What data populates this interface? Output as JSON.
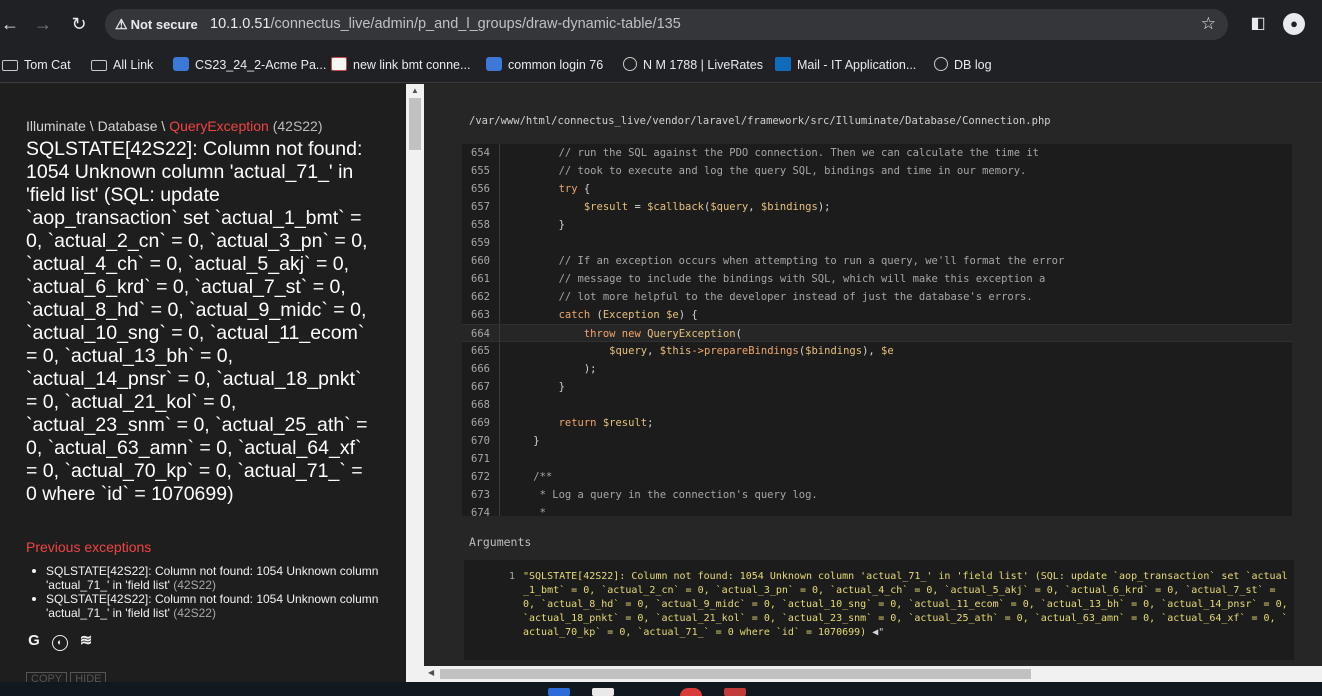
{
  "browser": {
    "security_label": "Not secure",
    "url_host": "10.1.0.51",
    "url_path": "/connectus_live/admin/p_and_l_groups/draw-dynamic-table/135"
  },
  "bookmarks": [
    {
      "label": "Tom Cat",
      "icon": "folder-icon"
    },
    {
      "label": "All Link",
      "icon": "folder-icon"
    },
    {
      "label": "CS23_24_2-Acme Pa...",
      "icon": "grid-favicon"
    },
    {
      "label": "new link bmt conne...",
      "icon": "image-favicon"
    },
    {
      "label": "common login 76",
      "icon": "grid-favicon"
    },
    {
      "label": "N M 1788 | LiveRates",
      "icon": "globe-icon"
    },
    {
      "label": "Mail - IT Application...",
      "icon": "outlook-icon"
    },
    {
      "label": "DB log",
      "icon": "globe-icon"
    }
  ],
  "error": {
    "namespace_1": "Illuminate",
    "namespace_2": "Database",
    "namespace_sep": " \\ ",
    "exception_class": "QueryException",
    "code": "(42S22)",
    "message": "SQLSTATE[42S22]: Column not found: 1054 Unknown column 'actual_71_' in 'field list' (SQL: update `aop_transaction` set `actual_1_bmt` = 0, `actual_2_cn` = 0, `actual_3_pn` = 0, `actual_4_ch` = 0, `actual_5_akj` = 0, `actual_6_krd` = 0, `actual_7_st` = 0, `actual_8_hd` = 0, `actual_9_midc` = 0, `actual_10_sng` = 0, `actual_11_ecom` = 0, `actual_13_bh` = 0, `actual_14_pnsr` = 0, `actual_18_pnkt` = 0, `actual_21_kol` = 0, `actual_23_snm` = 0, `actual_25_ath` = 0, `actual_63_amn` = 0, `actual_64_xf` = 0, `actual_70_kp` = 0, `actual_71_` = 0 where `id` = 1070699)"
  },
  "previous": {
    "title": "Previous exceptions",
    "items": [
      {
        "text": "SQLSTATE[42S22]: Column not found: 1054 Unknown column 'actual_71_' in 'field list'",
        "code": "(42S22)"
      },
      {
        "text": "SQLSTATE[42S22]: Column not found: 1054 Unknown column 'actual_71_' in 'field list'",
        "code": "(42S22)"
      }
    ]
  },
  "search_icons": [
    "google-icon",
    "duckduckgo-icon",
    "stackoverflow-icon"
  ],
  "buttons": {
    "copy": "COPY",
    "hide": "HIDE"
  },
  "source": {
    "file_path": "/var/www/html/connectus_live/vendor/laravel/framework/src/Illuminate/Database/Connection.php",
    "highlight_line": 664,
    "lines": [
      {
        "n": "654",
        "code": "        // run the SQL against the PDO connection. Then we can calculate the time it"
      },
      {
        "n": "655",
        "code": "        // took to execute and log the query SQL, bindings and time in our memory."
      },
      {
        "n": "656",
        "code": "        try {"
      },
      {
        "n": "657",
        "code": "            $result = $callback($query, $bindings);"
      },
      {
        "n": "658",
        "code": "        }"
      },
      {
        "n": "659",
        "code": ""
      },
      {
        "n": "660",
        "code": "        // If an exception occurs when attempting to run a query, we'll format the error"
      },
      {
        "n": "661",
        "code": "        // message to include the bindings with SQL, which will make this exception a"
      },
      {
        "n": "662",
        "code": "        // lot more helpful to the developer instead of just the database's errors."
      },
      {
        "n": "663",
        "code": "        catch (Exception $e) {"
      },
      {
        "n": "664",
        "code": "            throw new QueryException("
      },
      {
        "n": "665",
        "code": "                $query, $this->prepareBindings($bindings), $e"
      },
      {
        "n": "666",
        "code": "            );"
      },
      {
        "n": "667",
        "code": "        }"
      },
      {
        "n": "668",
        "code": ""
      },
      {
        "n": "669",
        "code": "        return $result;"
      },
      {
        "n": "670",
        "code": "    }"
      },
      {
        "n": "671",
        "code": ""
      },
      {
        "n": "672",
        "code": "    /**"
      },
      {
        "n": "673",
        "code": "     * Log a query in the connection's query log."
      },
      {
        "n": "674",
        "code": "     *"
      }
    ]
  },
  "arguments": {
    "title": "Arguments",
    "index": "1",
    "value": "\"SQLSTATE[42S22]: Column not found: 1054 Unknown column 'actual_71_' in 'field list' (SQL: update `aop_transaction` set `actual_1_bmt` = 0, `actual_2_cn` = 0, `actual_3_pn` = 0, `actual_4_ch` = 0, `actual_5_akj` = 0, `actual_6_krd` = 0, `actual_7_st` = 0, `actual_8_hd` = 0, `actual_9_midc` = 0, `actual_10_sng` = 0, `actual_11_ecom` = 0, `actual_13_bh` = 0, `actual_14_pnsr` = 0, `actual_18_pnkt` = 0, `actual_21_kol` = 0, `actual_23_snm` = 0, `actual_25_ath` = 0, `actual_63_amn` = 0, `actual_64_xf` = 0, `actual_70_kp` = 0, `actual_71_` = 0 where `id` = 1070699) ",
    "tail": "◀\""
  },
  "colors": {
    "accent_red": "#ef4444",
    "string_yellow": "#e6db74",
    "keyword_orange": "#f0a66b"
  }
}
